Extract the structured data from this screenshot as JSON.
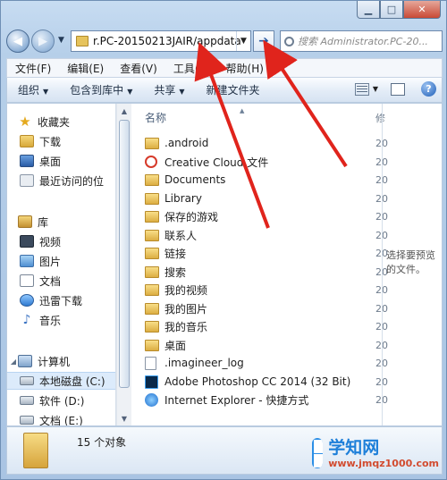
{
  "window": {
    "minimize_icon": "minimize-icon",
    "maximize_icon": "maximize-icon",
    "close_icon": "close-icon"
  },
  "address": {
    "path": "r.PC-20150213JAIR/appdata",
    "go_icon": "arrow-right-icon"
  },
  "search": {
    "placeholder": "搜索 Administrator.PC-20..."
  },
  "menubar": {
    "items": [
      "文件(F)",
      "编辑(E)",
      "查看(V)",
      "工具(T)",
      "帮助(H)"
    ]
  },
  "toolbar": {
    "organize": "组织",
    "include_in_library": "包含到库中",
    "share": "共享",
    "new_folder": "新建文件夹"
  },
  "navpane": {
    "favorites_header": "收藏夹",
    "favorites": [
      "下载",
      "桌面",
      "最近访问的位"
    ],
    "libraries_header": "库",
    "libraries": [
      "视频",
      "图片",
      "文档",
      "迅雷下载",
      "音乐"
    ],
    "computer_header": "计算机",
    "drives": [
      "本地磁盘 (C:)",
      "软件 (D:)",
      "文档 (E:)"
    ]
  },
  "filelist": {
    "name_header": "名称",
    "date_header": "修",
    "date_value": "20",
    "items": [
      {
        "name": ".android",
        "icon": "folder-icon"
      },
      {
        "name": "Creative Cloud 文件",
        "icon": "creative-cloud-icon"
      },
      {
        "name": "Documents",
        "icon": "folder-icon"
      },
      {
        "name": "Library",
        "icon": "folder-icon"
      },
      {
        "name": "保存的游戏",
        "icon": "saved-games-icon"
      },
      {
        "name": "联系人",
        "icon": "contacts-icon"
      },
      {
        "name": "链接",
        "icon": "links-icon"
      },
      {
        "name": "搜索",
        "icon": "searches-icon"
      },
      {
        "name": "我的视频",
        "icon": "folder-icon"
      },
      {
        "name": "我的图片",
        "icon": "folder-icon"
      },
      {
        "name": "我的音乐",
        "icon": "folder-icon"
      },
      {
        "name": "桌面",
        "icon": "desktop-folder-icon"
      },
      {
        "name": ".imagineer_log",
        "icon": "file-icon"
      },
      {
        "name": "Adobe Photoshop CC 2014 (32 Bit)",
        "icon": "photoshop-icon"
      },
      {
        "name": "Internet Explorer - 快捷方式",
        "icon": "internet-explorer-icon"
      }
    ]
  },
  "preview": {
    "message": "选择要预览的文件。"
  },
  "details": {
    "count": "15 个对象"
  },
  "watermark": {
    "title": "学知网",
    "url": "www.jmqz1000.com"
  },
  "colors": {
    "annotation_arrow": "#e0241c",
    "watermark_blue": "#1d7fd9"
  }
}
